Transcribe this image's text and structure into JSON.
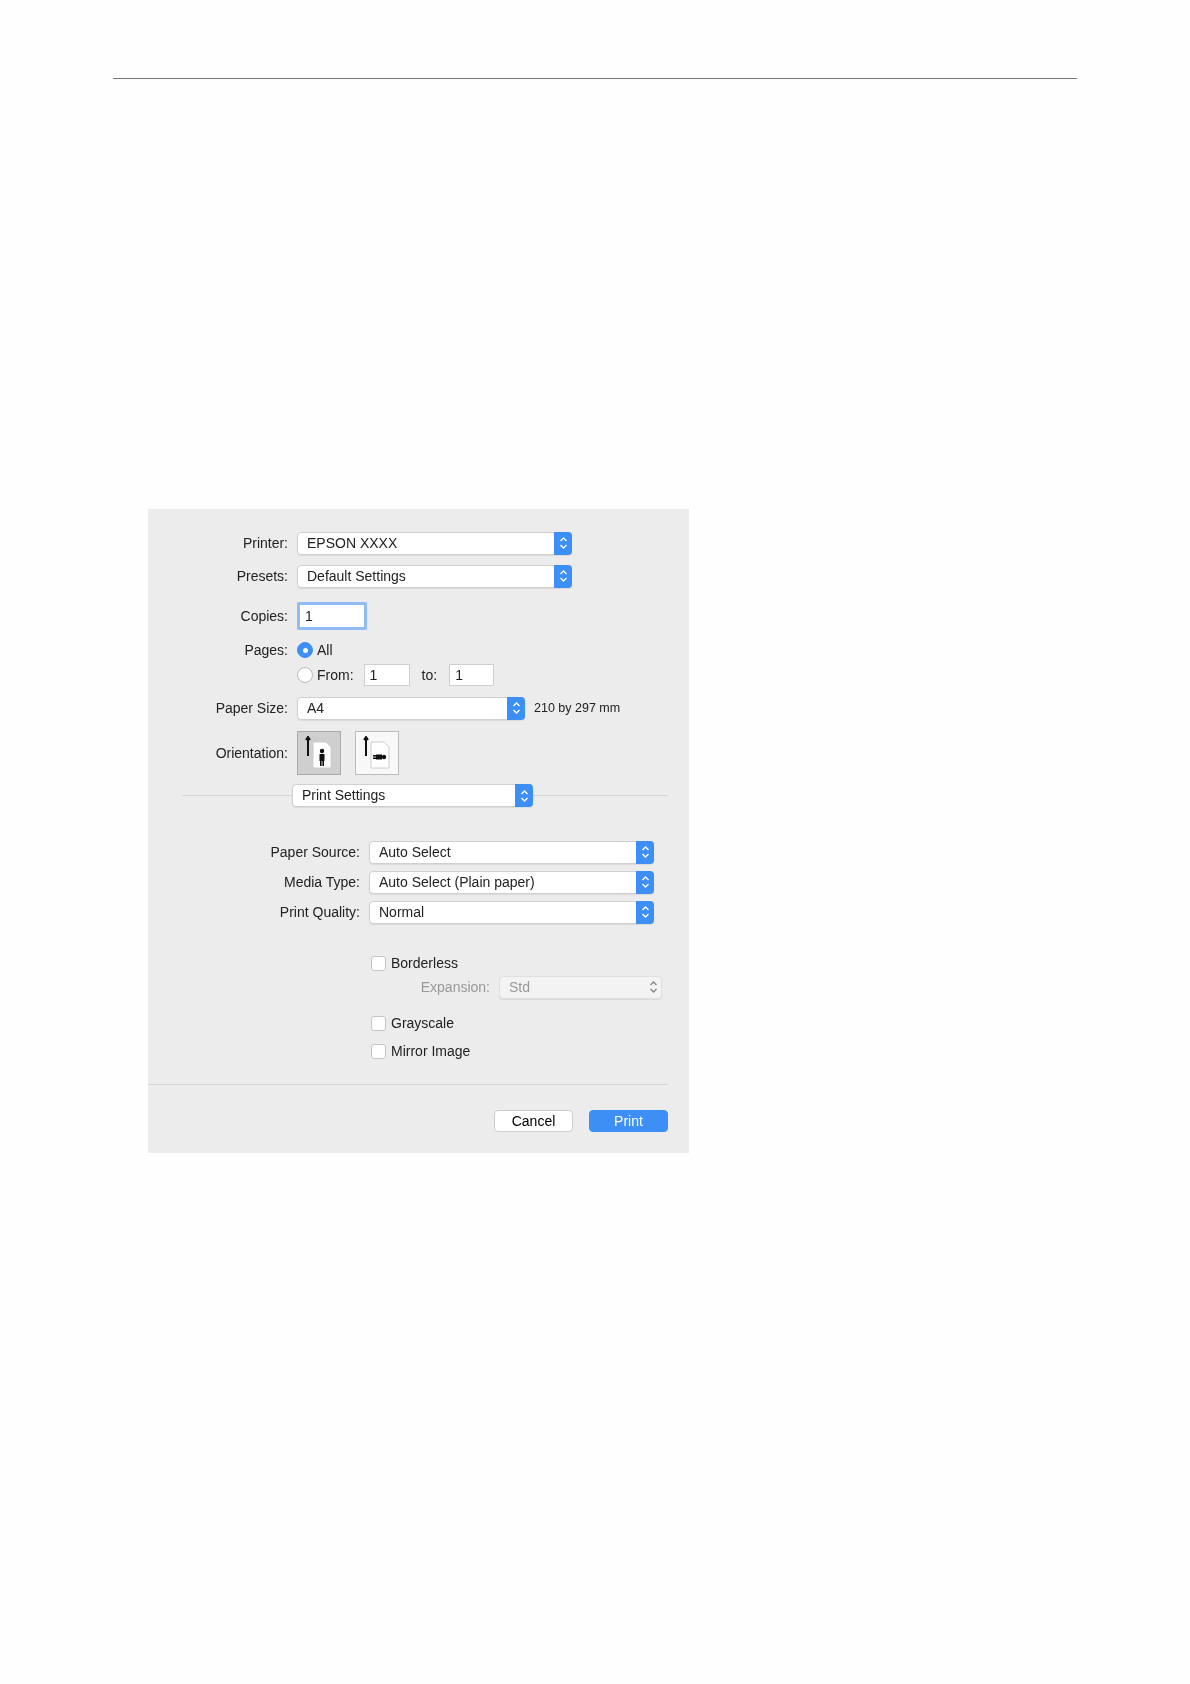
{
  "dialog": {
    "printer": {
      "label": "Printer:",
      "value": "EPSON XXXX"
    },
    "presets": {
      "label": "Presets:",
      "value": "Default Settings"
    },
    "copies": {
      "label": "Copies:",
      "value": "1",
      "focused": true
    },
    "pages": {
      "label": "Pages:",
      "options": [
        {
          "kind": "all",
          "label": "All",
          "selected": true
        },
        {
          "kind": "range",
          "label": "From:",
          "selected": false,
          "from": "1",
          "to_label": "to:",
          "to": "1"
        }
      ]
    },
    "paper_size": {
      "label": "Paper Size:",
      "value": "A4",
      "note": "210 by 297 mm"
    },
    "orientation": {
      "label": "Orientation:",
      "options": [
        {
          "kind": "portrait",
          "selected": true
        },
        {
          "kind": "landscape",
          "selected": false
        }
      ]
    },
    "panel_menu": {
      "value": "Print Settings"
    },
    "settings": [
      {
        "label": "Paper Source:",
        "value": "Auto Select"
      },
      {
        "label": "Media Type:",
        "value": "Auto Select (Plain paper)"
      },
      {
        "label": "Print Quality:",
        "value": "Normal"
      }
    ],
    "checkboxes": [
      {
        "label": "Borderless",
        "checked": false,
        "sub": {
          "label": "Expansion:",
          "value": "Std",
          "disabled": true
        }
      },
      {
        "label": "Grayscale",
        "checked": false
      },
      {
        "label": "Mirror Image",
        "checked": false
      }
    ],
    "buttons": [
      {
        "label": "Cancel",
        "kind": "default"
      },
      {
        "label": "Print",
        "kind": "primary"
      }
    ]
  }
}
